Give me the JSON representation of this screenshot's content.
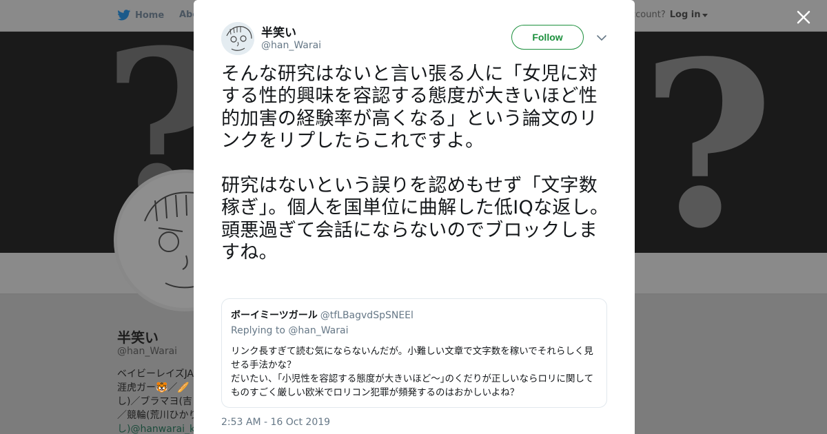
{
  "background_page": {
    "nav": {
      "home_label": "Home",
      "about_label": "Abo",
      "account_prompt": "ccount?",
      "login_label": "Log in"
    },
    "profile": {
      "name": "半笑い",
      "handle": "@han_Warai",
      "bio_lines": [
        "ベイビーレイズJA",
        "涯虎ガー🐯／🥖",
        "し)／ブラマヨ(吉",
        "／競輪(荒川ひかり",
        "し)@hanwarai_ke"
      ]
    }
  },
  "tweet": {
    "author_name": "半笑い",
    "author_handle": "@han_Warai",
    "follow_label": "Follow",
    "paragraph_1": "そんな研究はないと言い張る人に「女児に対する性的興味を容認する態度が大きいほど性的加害の経験率が高くなる」という論文のリンクをリプしたらこれですよ。",
    "paragraph_2": "研究はないという誤りを認めもせず「文字数稼ぎ」。個人を国単位に曲解した低IQな返し。",
    "paragraph_3": "頭悪過ぎて会話にならないのでブロックしますね。",
    "timestamp": "2:53 AM - 16 Oct 2019"
  },
  "quoted_tweet": {
    "author_name": "ボーイミーツガール",
    "author_handle": "@tfLBagvdSpSNEEl",
    "replying_to": "Replying to @han_Warai",
    "body_line_1": "リンク長すぎて読む気にならないんだが。小難しい文章で文字数を稼いでそれらしく見せる手法かな？",
    "body_line_2": "だいたい、｢小児性を容認する態度が大きいほど～｣のくだりが正しいならロリに関してものすごく厳しい欧米でロリコン犯罪が頻発するのはおかしいよね？"
  },
  "colors": {
    "follow_accent": "#1b8f3c",
    "muted_text": "#657786",
    "overlay": "#7c7c7c"
  }
}
